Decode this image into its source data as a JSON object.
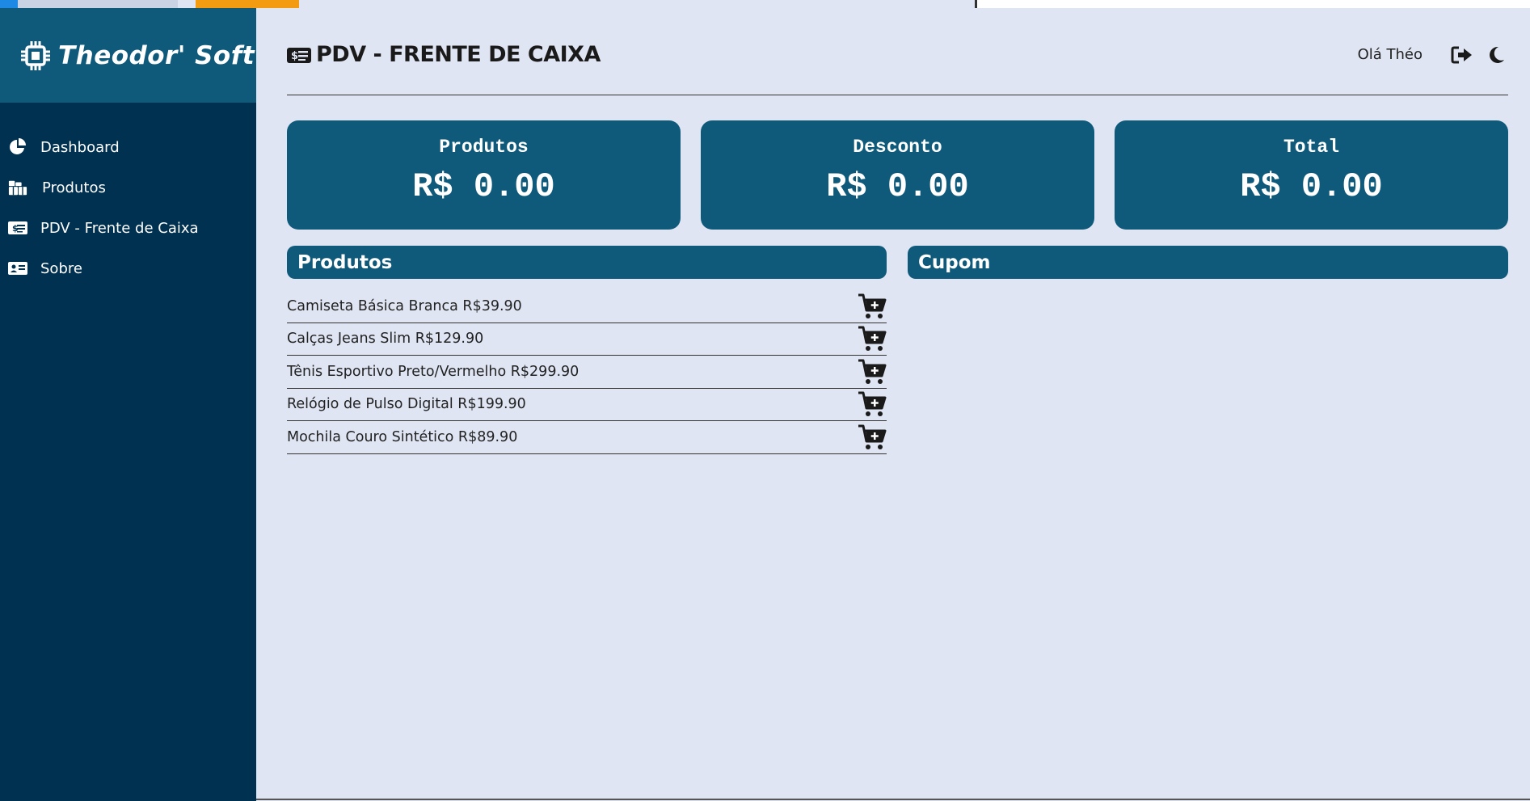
{
  "brand": {
    "name": "Theodor' Soft"
  },
  "sidebar": {
    "items": [
      {
        "label": "Dashboard",
        "icon": "chart-pie-icon"
      },
      {
        "label": "Produtos",
        "icon": "boxes-icon"
      },
      {
        "label": "PDV - Frente de Caixa",
        "icon": "money-check-icon"
      },
      {
        "label": "Sobre",
        "icon": "id-card-icon"
      }
    ]
  },
  "header": {
    "title": "PDV - FRENTE DE CAIXA",
    "greeting": "Olá Théo",
    "logout_icon": "sign-out-icon",
    "theme_icon": "moon-icon"
  },
  "cards": [
    {
      "label": "Produtos",
      "value": "R$ 0.00"
    },
    {
      "label": "Desconto",
      "value": "R$ 0.00"
    },
    {
      "label": "Total",
      "value": "R$ 0.00"
    }
  ],
  "produtos_panel": {
    "title": "Produtos",
    "items": [
      {
        "text": "Camiseta Básica Branca R$39.90"
      },
      {
        "text": "Calças Jeans Slim R$129.90"
      },
      {
        "text": "Tênis Esportivo Preto/Vermelho R$299.90"
      },
      {
        "text": "Relógio de Pulso Digital R$199.90"
      },
      {
        "text": "Mochila Couro Sintético R$89.90"
      }
    ]
  },
  "cupom_panel": {
    "title": "Cupom"
  },
  "colors": {
    "sidebar": "#003150",
    "accent": "#0f5a7a",
    "background": "#dfe5f3"
  }
}
